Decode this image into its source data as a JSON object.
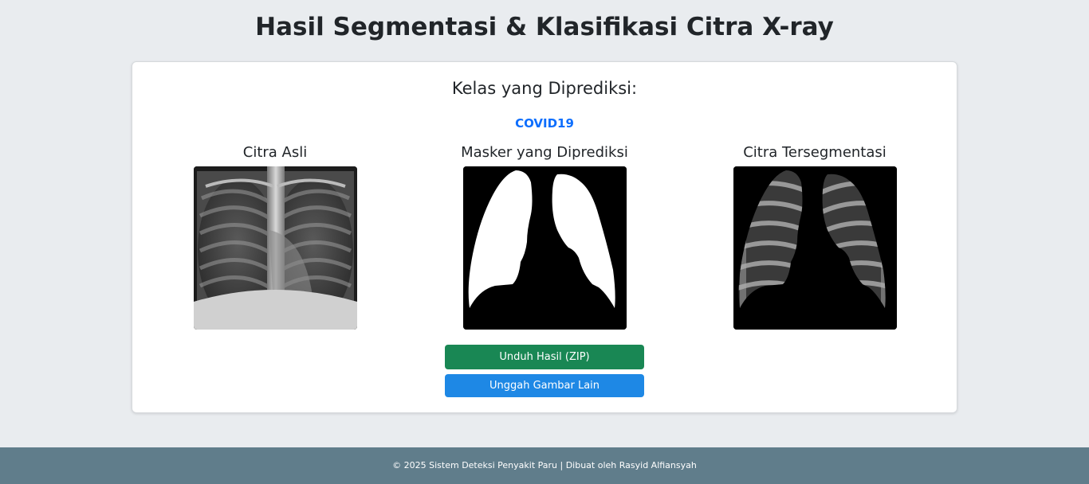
{
  "page": {
    "title": "Hasil Segmentasi & Klasifikasi Citra X-ray"
  },
  "result": {
    "heading": "Kelas yang Diprediksi:",
    "predicted_class": "COVID19",
    "predicted_class_color": "#0d6efd"
  },
  "images": [
    {
      "caption": "Citra Asli"
    },
    {
      "caption": "Masker yang Diprediksi"
    },
    {
      "caption": "Citra Tersegmentasi"
    }
  ],
  "actions": {
    "download_label": "Unduh Hasil (ZIP)",
    "download_color": "#198754",
    "upload_label": "Unggah Gambar Lain",
    "upload_color": "#1e88e5"
  },
  "footer": {
    "text": "© 2025 Sistem Deteksi Penyakit Paru | Dibuat oleh Rasyid Alfiansyah",
    "background": "#607d8b"
  },
  "theme": {
    "background": "#e9ecef"
  }
}
